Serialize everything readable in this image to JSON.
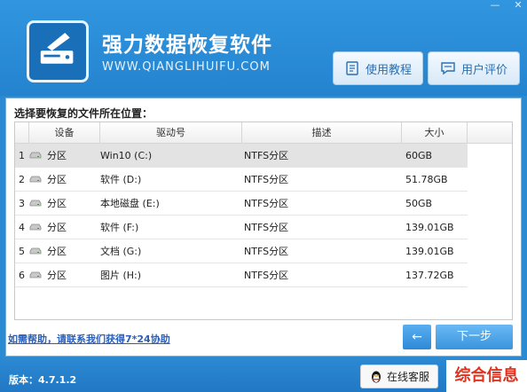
{
  "app": {
    "title": "强力数据恢复软件",
    "url": "WWW.QIANGLIHUIFU.COM",
    "version": "版本：4.7.1.2"
  },
  "window_controls": {
    "minimize": "—",
    "close": "✕"
  },
  "toolbar": {
    "tutorial_label": "使用教程",
    "review_label": "用户评价"
  },
  "panel": {
    "title": "选择要恢复的文件所在位置：",
    "columns": [
      "设备",
      "驱动号",
      "描述",
      "大小"
    ],
    "rows": [
      {
        "index": "1",
        "device": "分区",
        "drive": "Win10 (C:)",
        "desc": "NTFS分区",
        "size": "60GB",
        "selected": true
      },
      {
        "index": "2",
        "device": "分区",
        "drive": "软件 (D:)",
        "desc": "NTFS分区",
        "size": "51.78GB",
        "selected": false
      },
      {
        "index": "3",
        "device": "分区",
        "drive": "本地磁盘 (E:)",
        "desc": "NTFS分区",
        "size": "50GB",
        "selected": false
      },
      {
        "index": "4",
        "device": "分区",
        "drive": "软件 (F:)",
        "desc": "NTFS分区",
        "size": "139.01GB",
        "selected": false
      },
      {
        "index": "5",
        "device": "分区",
        "drive": "文档 (G:)",
        "desc": "NTFS分区",
        "size": "139.01GB",
        "selected": false
      },
      {
        "index": "6",
        "device": "分区",
        "drive": "图片 (H:)",
        "desc": "NTFS分区",
        "size": "137.72GB",
        "selected": false
      }
    ]
  },
  "bottom": {
    "help_text": "如需帮助，请联系我们获得7*24协助",
    "back_label": "←",
    "next_label": "下一步"
  },
  "footer": {
    "service_label": "在线客服",
    "watermark": "综合信息"
  },
  "colors": {
    "brand_blue": "#2483cf",
    "watermark_red": "#e0321e"
  }
}
